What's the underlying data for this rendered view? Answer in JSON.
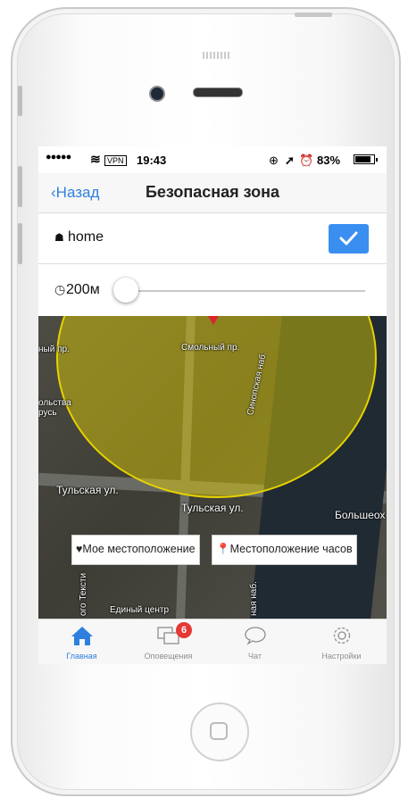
{
  "status_bar": {
    "signal": "●●●●●",
    "vpn": "VPN",
    "time": "19:43",
    "battery": "83%"
  },
  "nav": {
    "back_label": "Назад",
    "title": "Безопасная зона"
  },
  "zone": {
    "name": "home",
    "radius_label": "200м",
    "radius_slider_fraction": 0.0
  },
  "map": {
    "labels": [
      "Смольный пр.",
      "Синопская наб.",
      "ный пр.",
      "Тульская ул.",
      "Тульская ул.",
      "Большеох",
      "Единый центр",
      "ольства русь",
      "ная наб.",
      "ого Тексти"
    ],
    "buttons": {
      "my_location": "Мое местоположение",
      "watch_location": "Местоположение часов"
    }
  },
  "tabbar": {
    "tabs": [
      {
        "label": "Главная",
        "icon": "home-icon"
      },
      {
        "label": "Оповещения",
        "icon": "chat-bubbles-icon",
        "badge": "6"
      },
      {
        "label": "Чат",
        "icon": "speech-bubble-icon"
      },
      {
        "label": "Настройки",
        "icon": "gear-icon"
      }
    ],
    "active_color": "#2f7fdf"
  },
  "colors": {
    "accent": "#3a8ef0",
    "zone_fill": "#e6d200",
    "pin": "#d8262b",
    "badge": "#e53935"
  }
}
